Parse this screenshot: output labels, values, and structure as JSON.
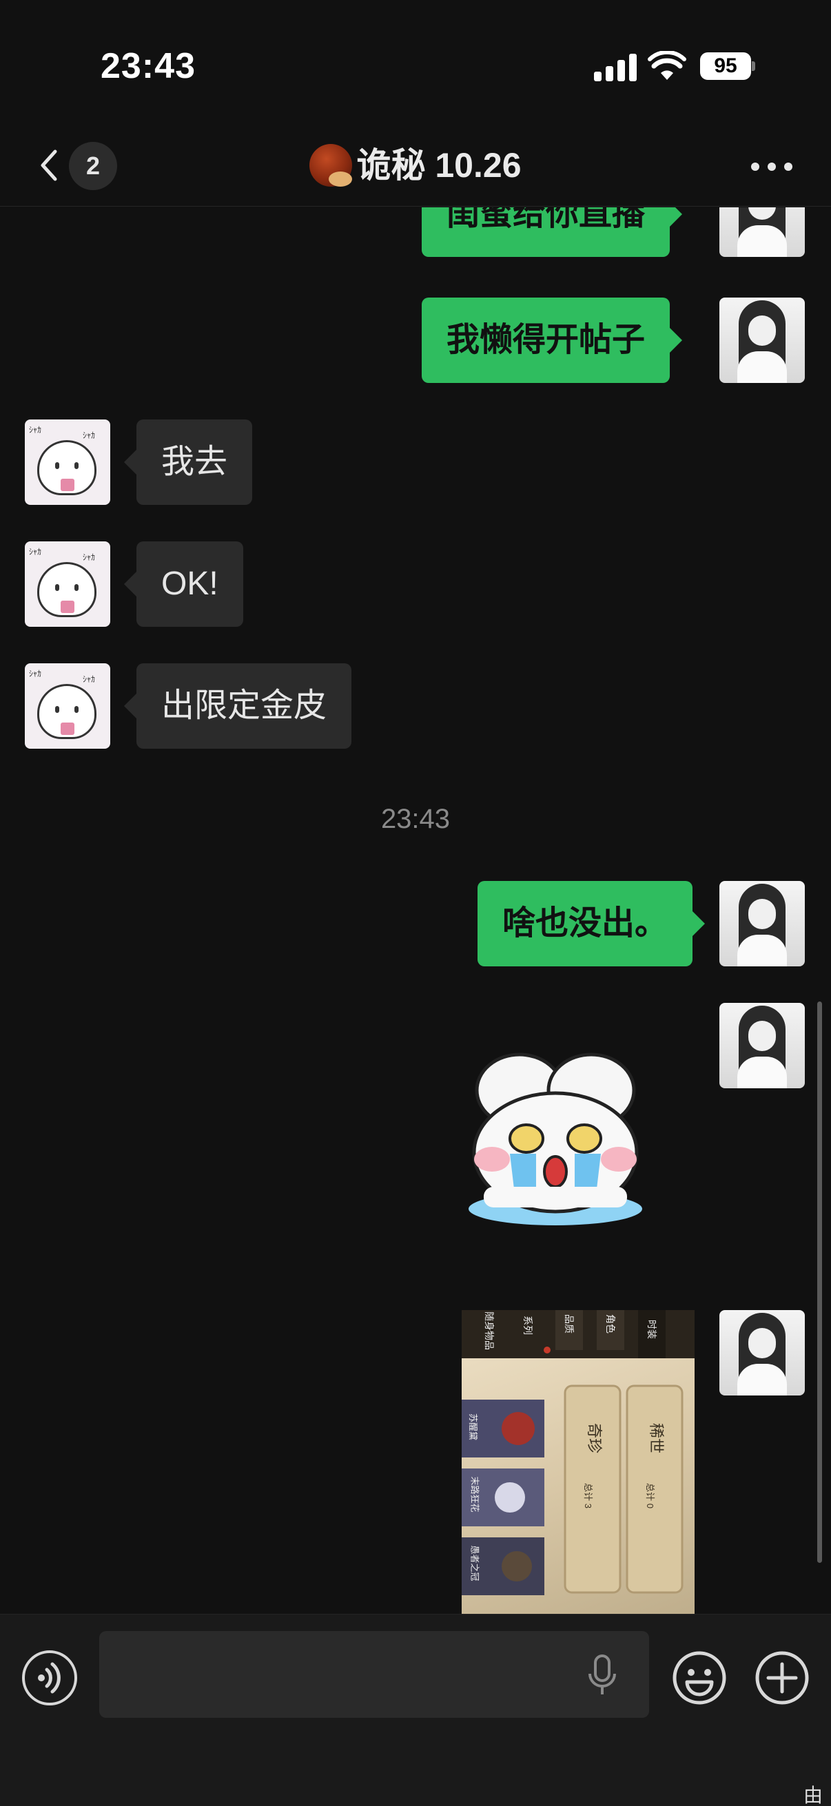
{
  "status_bar": {
    "time": "23:43",
    "battery_percent": "95"
  },
  "header": {
    "unread_count": "2",
    "title": "诡秘 10.26",
    "title_icon": "chestnut-icon"
  },
  "messages": [
    {
      "side": "out",
      "text": "闺蜜给你直播"
    },
    {
      "side": "out",
      "text": "我懒得开帖子"
    },
    {
      "side": "in",
      "text": "我去"
    },
    {
      "side": "in",
      "text": "OK!"
    },
    {
      "side": "in",
      "text": "出限定金皮"
    },
    {
      "type": "time",
      "text": "23:43"
    },
    {
      "side": "out",
      "text": "啥也没出。"
    },
    {
      "side": "out",
      "type": "sticker",
      "icon": "crying-bunny-sticker"
    },
    {
      "side": "out",
      "type": "photo"
    }
  ],
  "photo": {
    "tabs": [
      "时装",
      "角色",
      "品质",
      "系列",
      "随身物品"
    ],
    "cards": [
      {
        "title": "稀世",
        "subtitle": "总计 0"
      },
      {
        "title": "奇珍",
        "subtitle": "总计 3"
      }
    ],
    "items": [
      "苏醒黛",
      "末路狂花",
      "愚者之冠"
    ]
  },
  "input_bar": {
    "placeholder": ""
  },
  "footer": {
    "corner_glyph": "由"
  },
  "colors": {
    "background": "#111111",
    "outgoing_bubble": "#2fbd5f",
    "incoming_bubble": "#2b2b2b"
  }
}
